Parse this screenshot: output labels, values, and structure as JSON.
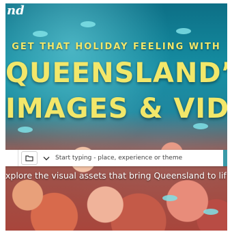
{
  "brand": {
    "logo_text": "nd"
  },
  "hero": {
    "kicker": "GET THAT HOLIDAY FEELING WITH",
    "headline_line1": "QUEENSLAND’S",
    "headline_line2": "IMAGES & VIDEO",
    "tagline": "xplore the visual assets that bring Queensland to lif"
  },
  "search": {
    "placeholder": "Start typing - place, experience or theme"
  },
  "colors": {
    "headline": "#f2e76a",
    "accent": "#3a9aa8"
  },
  "icons": [
    "folder-icon",
    "chevron-down-icon"
  ]
}
